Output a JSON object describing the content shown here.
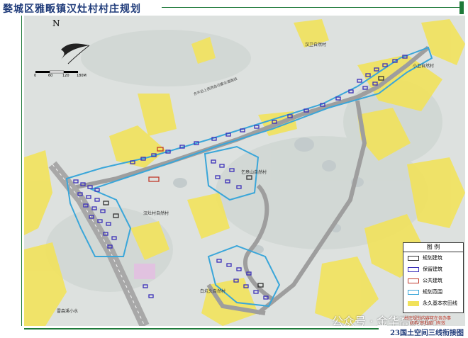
{
  "title": "婺城区雅畈镇汉灶村村庄规划",
  "footer": "23国土空间三线衔接图",
  "watermark": "公众号 · 金华高楼迷",
  "stamp": "村庄规划内容可在各办事机构·审批部门有效",
  "north": "N",
  "scale": {
    "ticks": [
      "0",
      "60",
      "120",
      "180M"
    ]
  },
  "legend": {
    "heading": "图    例",
    "items": [
      {
        "label": "规划建筑",
        "color": "#333333"
      },
      {
        "label": "保留建筑",
        "color": "#3b2fb8"
      },
      {
        "label": "公共建筑",
        "color": "#c0392b"
      },
      {
        "label": "规划范围",
        "color": "#3aa6d9"
      },
      {
        "label": "永久基本农田线",
        "color": "#f1e25a"
      }
    ]
  },
  "labels": {
    "village_top_right": "汉卫自然村",
    "village_top_right2": "小卫自然村",
    "village_center": "乞皋山自然村",
    "village_left": "汉灶村自然村",
    "village_bottom": "白坑头自然村",
    "river": "雷森溪小水",
    "road": "东平后上西西自动畜业道路线"
  },
  "colors": {
    "farmland": "#f2e35c",
    "building": "#3b2fb8",
    "boundary": "#3aa6d9",
    "road": "#9e9e9e"
  }
}
